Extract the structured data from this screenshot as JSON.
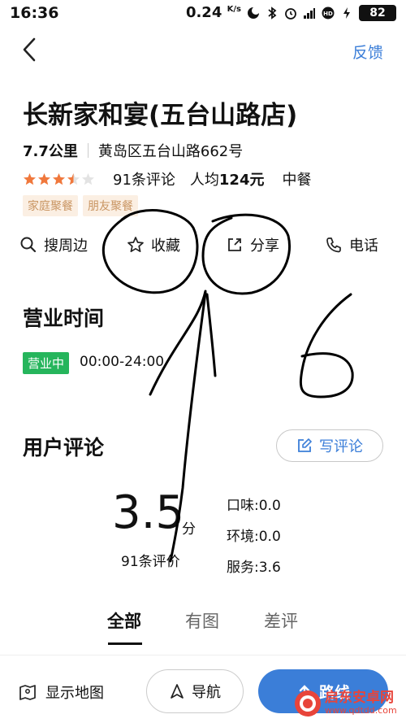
{
  "status_bar": {
    "time": "16:36",
    "net_speed": "0.24",
    "net_unit": "K/s",
    "battery": "82"
  },
  "nav": {
    "back_icon": "back-arrow-icon",
    "feedback": "反馈"
  },
  "shop": {
    "name": "长新家和宴(五台山路店)",
    "distance": "7.7公里",
    "address": "黄岛区五台山路662号",
    "star_rating": 3.5,
    "review_count": "91条评论",
    "avg_price_label": "人均",
    "avg_price_value": "124元",
    "category": "中餐",
    "tags": [
      "家庭聚餐",
      "朋友聚餐"
    ]
  },
  "actions": [
    {
      "icon": "search-icon",
      "label": "搜周边"
    },
    {
      "icon": "star-icon",
      "label": "收藏"
    },
    {
      "icon": "share-icon",
      "label": "分享"
    },
    {
      "icon": "phone-icon",
      "label": "电话"
    }
  ],
  "business_hours": {
    "title": "营业时间",
    "status": "营业中",
    "hours": "00:00-24:00"
  },
  "reviews": {
    "title": "用户评论",
    "write_button": "写评论",
    "score": "3.5",
    "score_unit": "分",
    "count_text": "91条评价",
    "subscores": [
      {
        "label": "口味:",
        "value": "0.0"
      },
      {
        "label": "环境:",
        "value": "0.0"
      },
      {
        "label": "服务:",
        "value": "3.6"
      }
    ],
    "tabs": [
      "全部",
      "有图",
      "差评"
    ],
    "active_tab": "全部"
  },
  "bottom_bar": {
    "map_button": "显示地图",
    "nav_button": "导航",
    "route_button": "路线"
  },
  "watermark": {
    "text1": "启东安卓网",
    "text2": "www.qdtdd.com"
  },
  "colors": {
    "accent_blue": "#3b7ed8",
    "star_orange": "#f0783c",
    "open_green": "#26b55c",
    "tag_bg": "#fbefe3"
  }
}
